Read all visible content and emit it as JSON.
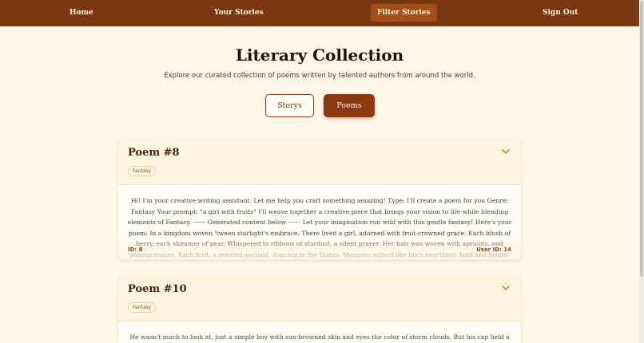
{
  "nav": {
    "home": "Home",
    "your_stories": "Your Stories",
    "filter_stories": "Filter Stories",
    "sign_out": "Sign Out"
  },
  "header": {
    "title": "Literary Collection",
    "subtitle": "Explore our curated collection of poems written by talented authors from around the world."
  },
  "filters": {
    "storys": "Storys",
    "poems": "Poems",
    "active": "Poems"
  },
  "colors": {
    "nav_bg": "#7a3810",
    "accent": "#8b3a12",
    "page_bg": "#fdf8e8"
  },
  "cards": [
    {
      "title": "Poem #8",
      "genre": "Fantasy",
      "body": "Hi! I'm your creative writing assistant. Let me help you craft something amazing! Type: I'll create a poem for you Genre: Fantasy Your prompt: \"a girl with fruits\" I'll weave together a creative piece that brings your vision to life while blending elements of Fantasy. ------ Generated content below ------ Let your imagination run wild with this gentle fantasy! Here's your poem: In a kingdom woven 'tween starlight's embrace, There lived a girl, adorned with fruit-crowned grace. Each blush of berry, each shimmer of pear, Whispered to ribbons of stardust, a silent prayer. Her hair was woven with apricots, and pomegranates. Each fruit, a jeweled garland, dancing in the States. Mangoes pulsed like life's heartbeat, bold and bright, While peaches kissed the",
      "id_label": "ID: 8",
      "user_label": "User ID: 14"
    },
    {
      "title": "Poem #10",
      "genre": "Fantasy",
      "body": "He wasn't much to look at, just a simple boy with sun-browned skin and eyes the color of storm clouds. But his cap held a magic"
    }
  ]
}
